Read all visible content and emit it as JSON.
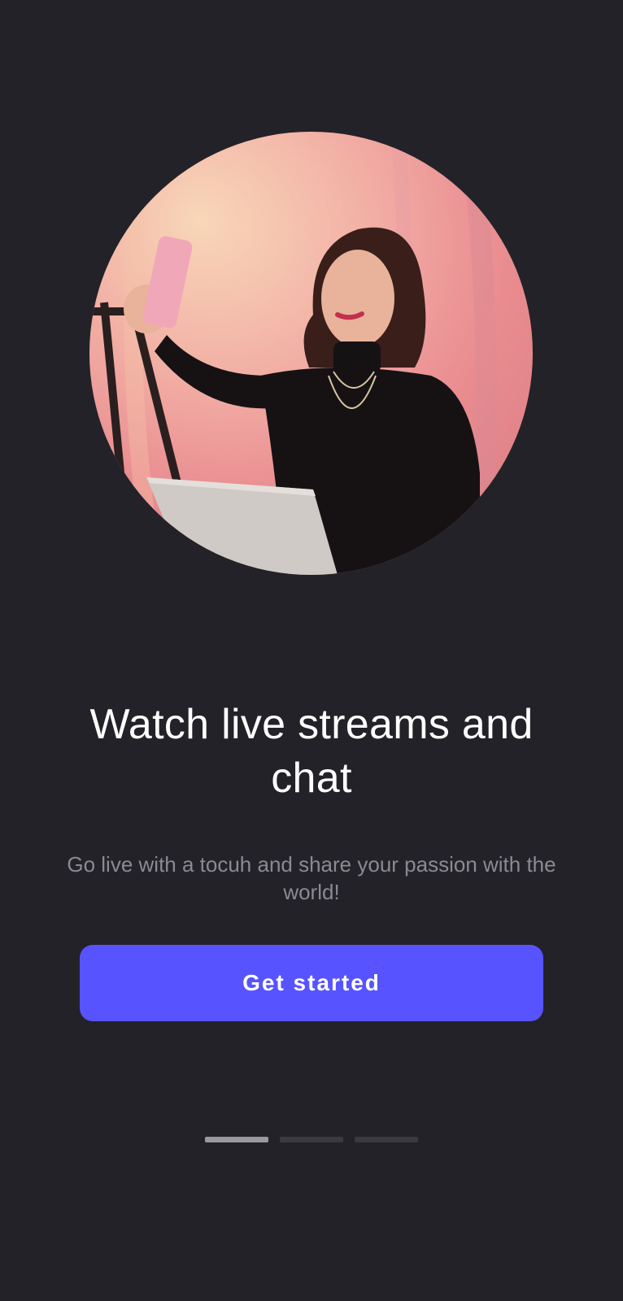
{
  "onboarding": {
    "title": "Watch live streams and chat",
    "subtitle": "Go live with a tocuh and share your passion with the world!",
    "cta_label": "Get started",
    "pages_total": 3,
    "active_page": 1
  },
  "colors": {
    "background": "#232228",
    "title": "#ffffff",
    "subtitle": "#8b8a92",
    "accent": "#5753ff",
    "indicator_active": "#9a99a0",
    "indicator_inactive": "#3b3a40"
  },
  "image": {
    "subject": "woman-taking-selfie-with-laptop"
  }
}
